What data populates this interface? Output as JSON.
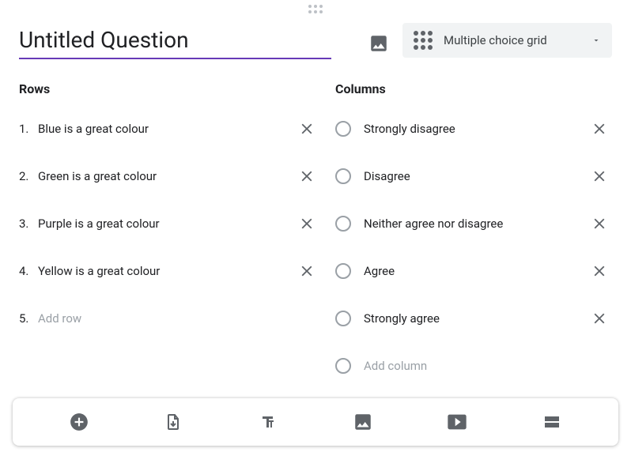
{
  "question": {
    "title": "Untitled Question",
    "type_label": "Multiple choice grid"
  },
  "rows": {
    "heading": "Rows",
    "items": [
      {
        "num": "1.",
        "label": "Blue is a great colour"
      },
      {
        "num": "2.",
        "label": "Green is a great colour"
      },
      {
        "num": "3.",
        "label": "Purple is a great colour"
      },
      {
        "num": "4.",
        "label": "Yellow is a great colour"
      }
    ],
    "add_num": "5.",
    "add_placeholder": "Add row"
  },
  "columns": {
    "heading": "Columns",
    "items": [
      {
        "label": "Strongly disagree"
      },
      {
        "label": "Disagree"
      },
      {
        "label": "Neither agree nor disagree"
      },
      {
        "label": "Agree"
      },
      {
        "label": "Strongly agree"
      }
    ],
    "add_placeholder": "Add column"
  }
}
